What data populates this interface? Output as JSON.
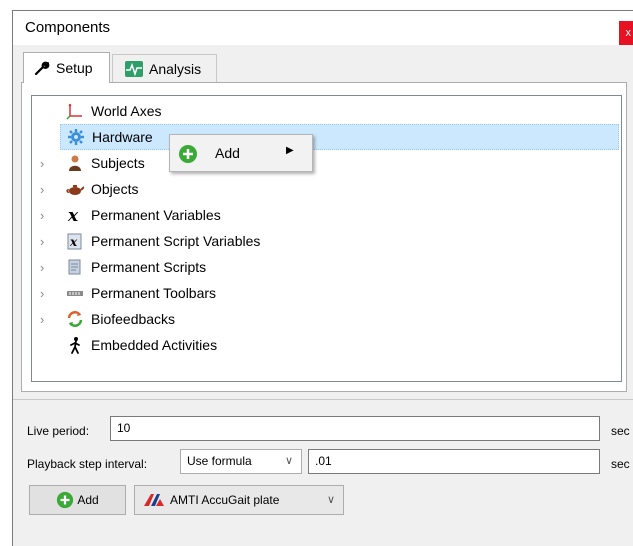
{
  "window": {
    "title": "Components",
    "close_label": "x"
  },
  "tabs": [
    {
      "label": "Setup",
      "icon": "wrench-icon"
    },
    {
      "label": "Analysis",
      "icon": "waveform-icon"
    }
  ],
  "tree": {
    "items": [
      {
        "label": "World Axes",
        "icon": "axes-icon",
        "expandable": false
      },
      {
        "label": "Hardware",
        "icon": "gear-icon",
        "expandable": false,
        "selected": true
      },
      {
        "label": "Subjects",
        "icon": "person-icon",
        "expandable": true
      },
      {
        "label": "Objects",
        "icon": "teapot-icon",
        "expandable": true
      },
      {
        "label": "Permanent Variables",
        "icon": "variable-icon",
        "expandable": true
      },
      {
        "label": "Permanent Script Variables",
        "icon": "script-variable-icon",
        "expandable": true
      },
      {
        "label": "Permanent Scripts",
        "icon": "scroll-icon",
        "expandable": true
      },
      {
        "label": "Permanent Toolbars",
        "icon": "toolbar-icon",
        "expandable": true
      },
      {
        "label": "Biofeedbacks",
        "icon": "feedback-loop-icon",
        "expandable": true
      },
      {
        "label": "Embedded Activities",
        "icon": "walking-figure-icon",
        "expandable": false
      }
    ]
  },
  "context_menu": {
    "label": "Add",
    "icon": "plus-circle-icon",
    "submenu_icon": "triangle-right-icon"
  },
  "settings": {
    "live_period_label": "Live period:",
    "live_period_value": "10",
    "live_period_unit": "sec",
    "playback_label": "Playback step interval:",
    "playback_mode": "Use formula",
    "playback_value": ".01",
    "playback_unit": "sec"
  },
  "bottom": {
    "add_label": "Add",
    "device_label": "AMTI AccuGait plate"
  },
  "colors": {
    "selection": "#cce8ff",
    "add_green": "#3aa935",
    "close_red": "#e81123"
  }
}
